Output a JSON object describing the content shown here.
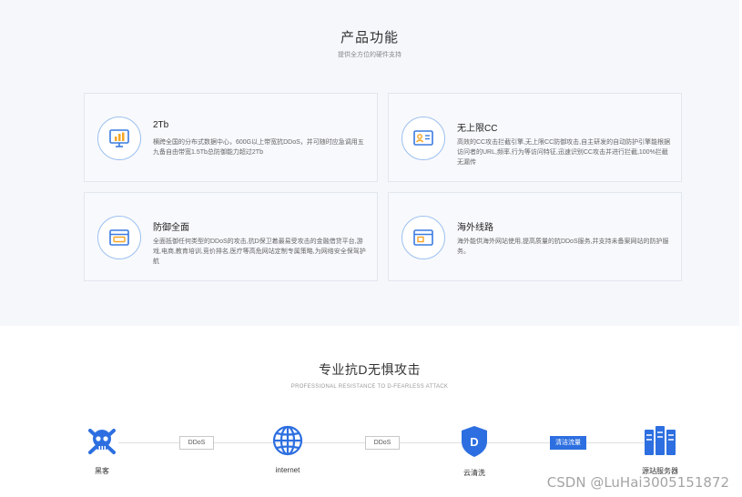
{
  "features": {
    "title": "产品功能",
    "subtitle": "提供全方位的硬件支持",
    "cards": [
      {
        "icon": "chart-monitor-icon",
        "title": "2Tb",
        "desc": "横跨全国的分布式数据中心，600G以上带宽抗DDoS，并可随时应急调用五九备自由带宽1.5Tb总防御能力超过2Tb"
      },
      {
        "icon": "id-card-icon",
        "title": "无上限CC",
        "desc": "高效的CC攻击拦截引擎,无上限CC防御攻击,自主研发的自动防护引擎能根据访问者的URL,频率,行为等访问特征,迅速识别CC攻击并进行拦截,100%拦截无漏传"
      },
      {
        "icon": "window-icon",
        "title": "防御全面",
        "desc": "全面抵御任何类型的DDoS的攻击,抗D保卫着最易受攻击的金融借贷平台,游戏,电商,教育培训,竞价排名,医疗等高危网站定制专属策略,为网络安全保驾护航"
      },
      {
        "icon": "browser-icon",
        "title": "海外线路",
        "desc": "海外能供海外网站使用,提高质量的抗DDoS服务,并支持未备案网站的防护服务。"
      }
    ]
  },
  "protection": {
    "title": "专业抗D无惧攻击",
    "subtitle": "PROFESSIONAL RESISTANCE TO D-FEARLESS ATTACK",
    "nodes": [
      {
        "icon": "skull-crossbones-icon",
        "label": "黑客"
      },
      {
        "icon": "globe-icon",
        "label": "internet"
      },
      {
        "icon": "shield-d-icon",
        "label": "云清洗"
      },
      {
        "icon": "server-icon",
        "label": "源站服务器"
      }
    ],
    "tags": [
      "DDoS",
      "DDoS",
      "清洁流量"
    ]
  },
  "colors": {
    "accent": "#2d6fe0",
    "icon_stroke": "#3a7be0",
    "section_bg": "#f5f7fb"
  },
  "watermark": "CSDN @LuHai3005151872"
}
